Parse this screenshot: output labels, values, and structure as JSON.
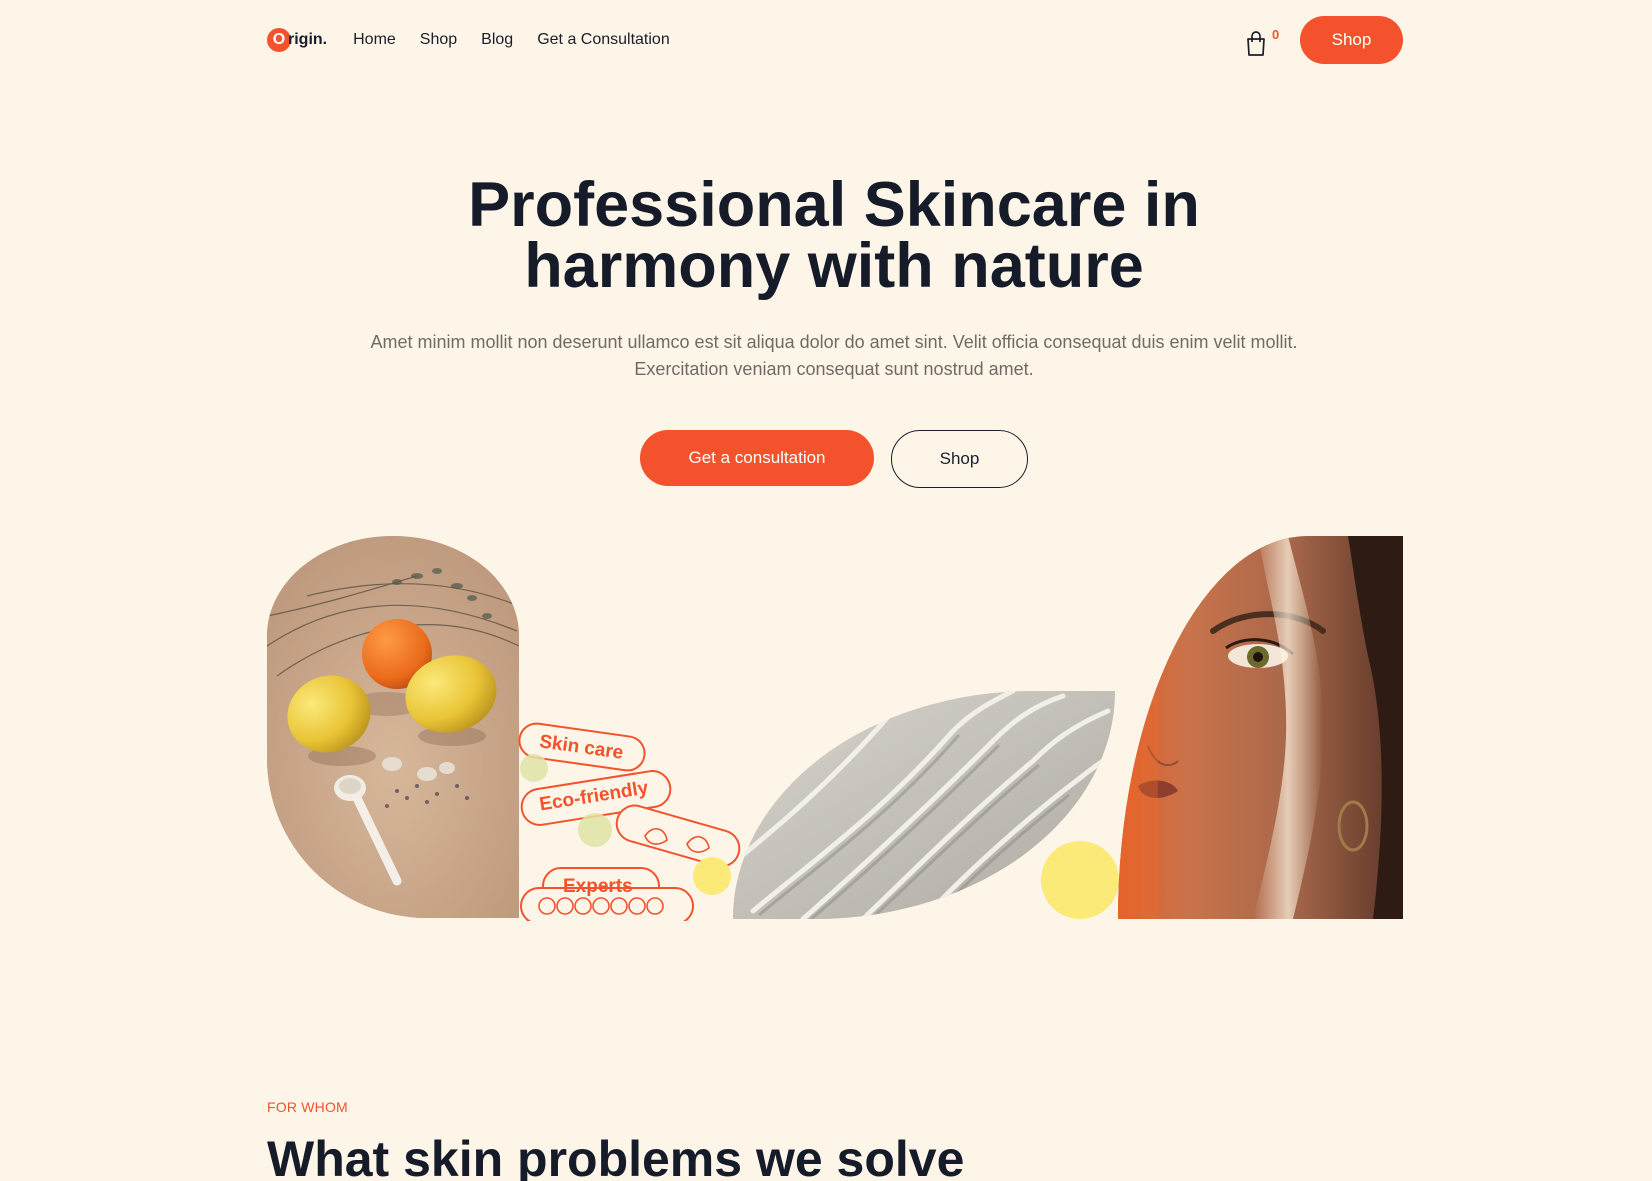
{
  "brand": {
    "logo_initial": "O",
    "logo_text": "rigin.",
    "accent_color": "#f4522d",
    "background_color": "#fdf6e8"
  },
  "nav": {
    "links": [
      "Home",
      "Shop",
      "Blog",
      "Get a Consultation"
    ],
    "cart_icon": "shopping-bag-icon",
    "cart_count": "0",
    "shop_button": "Shop"
  },
  "hero": {
    "title_line1": "Professional Skincare in",
    "title_line2": "harmony with nature",
    "subtitle": "Amet minim mollit non deserunt ullamco est sit aliqua dolor do amet sint. Velit officia consequat duis enim velit mollit. Exercitation veniam consequat sunt nostrud amet.",
    "primary_button": "Get a consultation",
    "secondary_button": "Shop"
  },
  "collage": {
    "tags": [
      "Skin care",
      "Eco-friendly",
      "Experts"
    ]
  },
  "for_whom": {
    "eyebrow": "FOR WHOM",
    "title": "What skin problems we solve"
  }
}
